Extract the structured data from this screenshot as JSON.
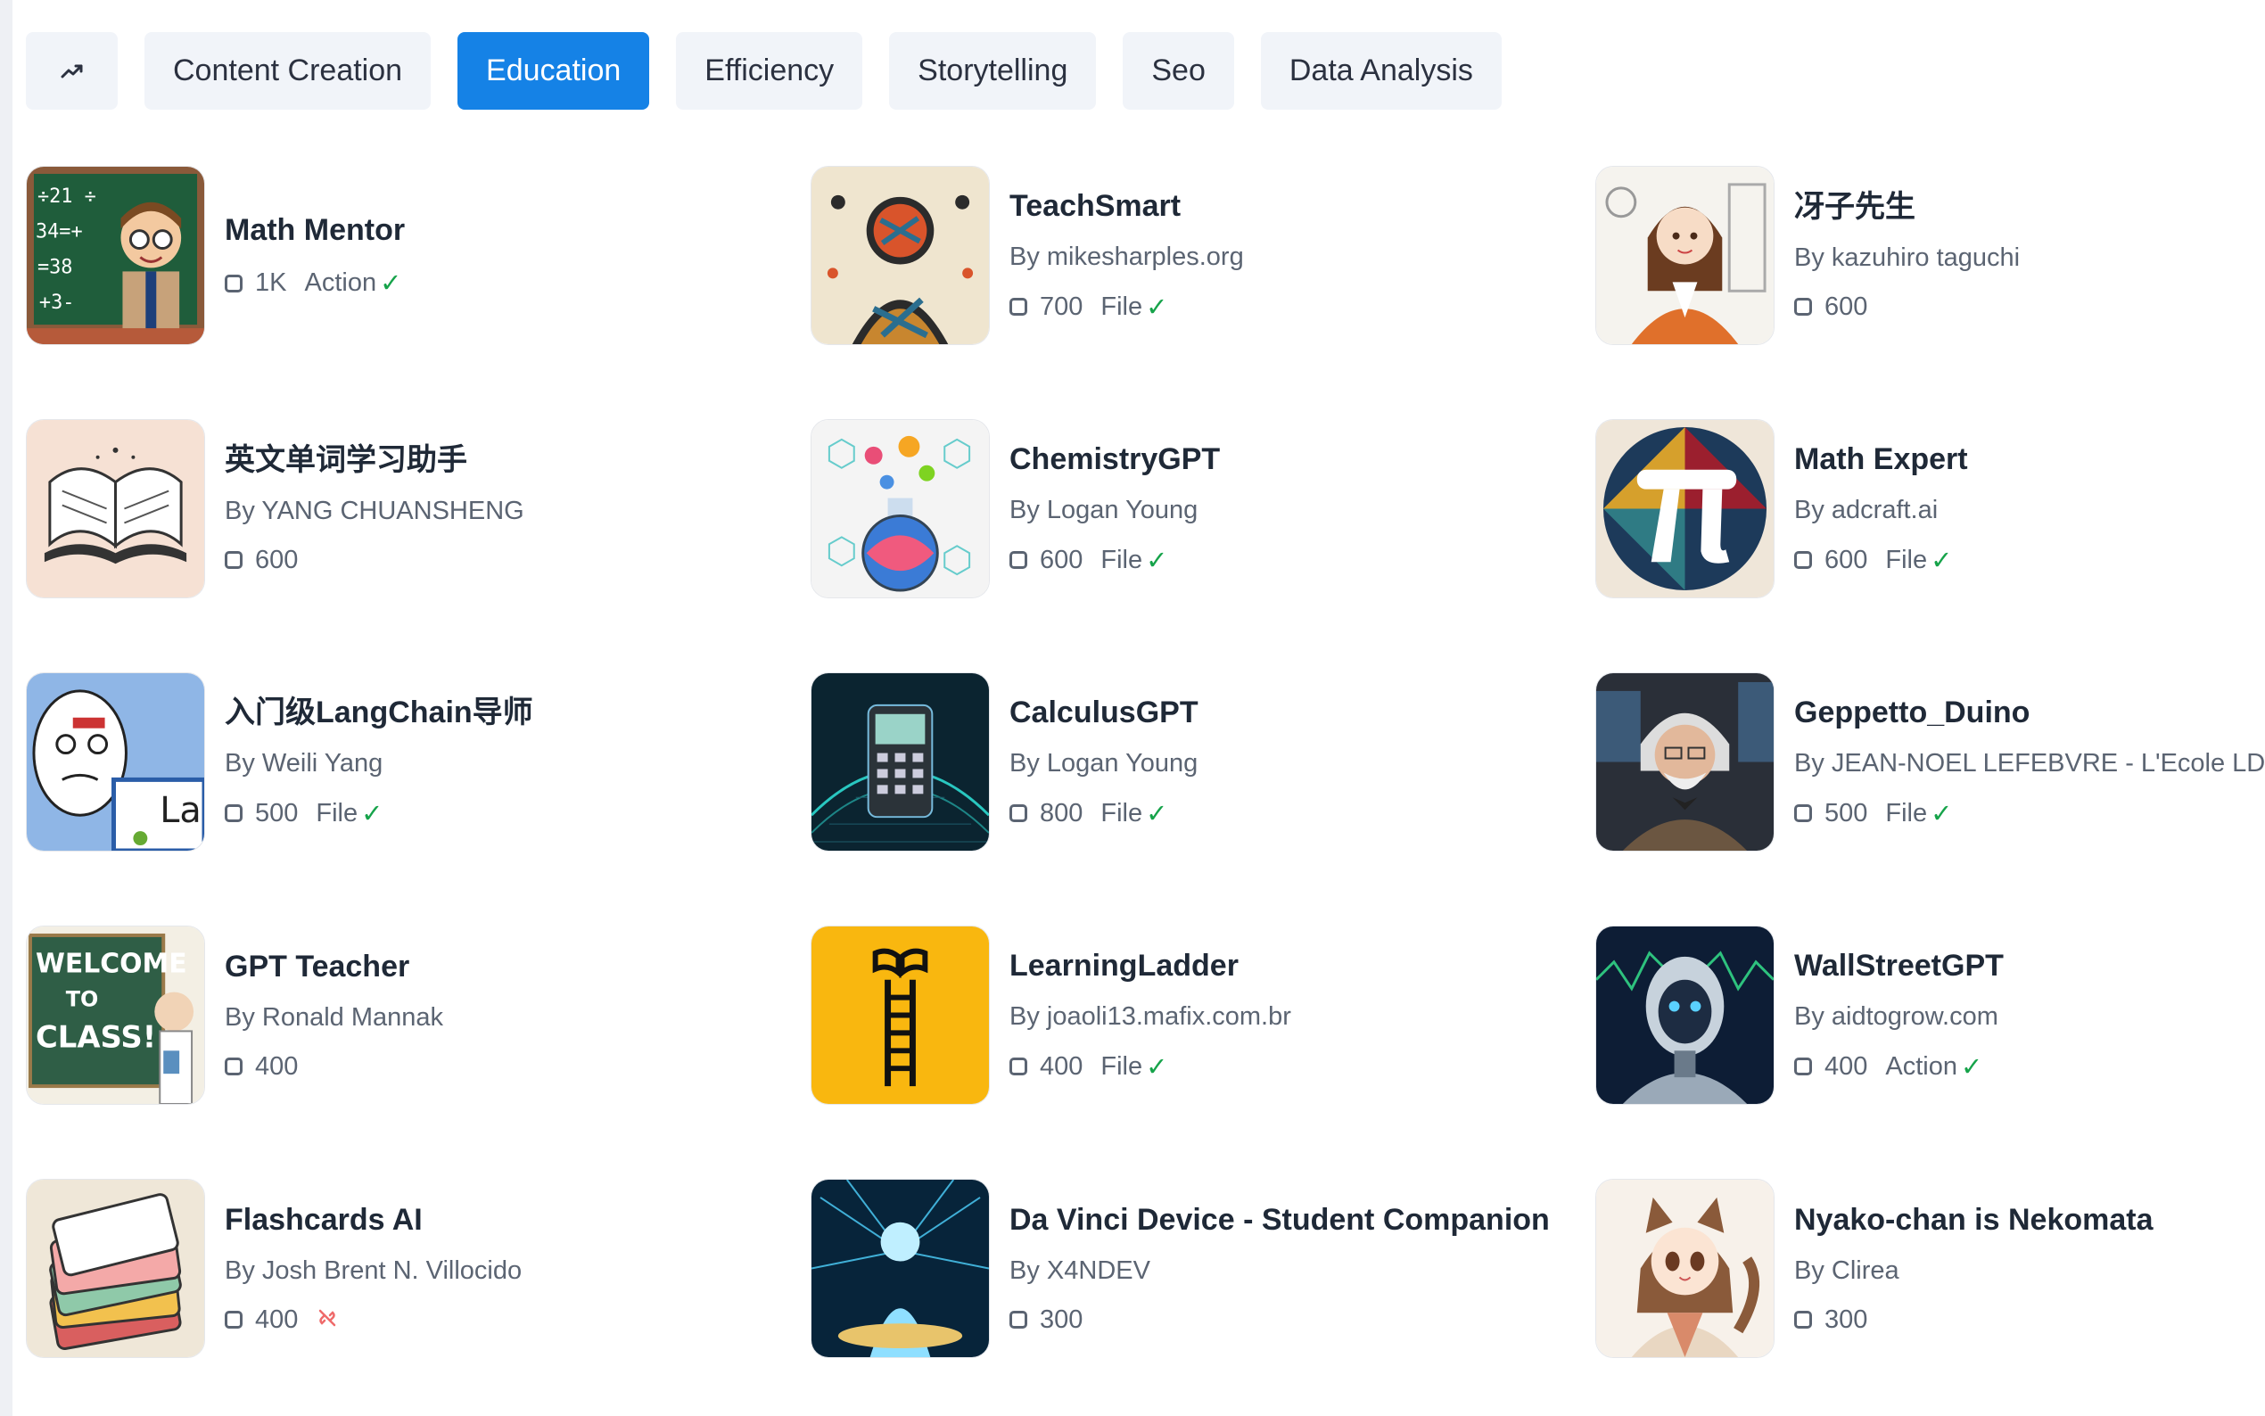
{
  "tabs": [
    {
      "label": "",
      "icon": "trending-up-icon",
      "active": false
    },
    {
      "label": "Content Creation",
      "active": false
    },
    {
      "label": "Education",
      "active": true
    },
    {
      "label": "Efficiency",
      "active": false
    },
    {
      "label": "Storytelling",
      "active": false
    },
    {
      "label": "Seo",
      "active": false
    },
    {
      "label": "Data Analysis",
      "active": false
    }
  ],
  "colors": {
    "accent": "#1582e6",
    "tab_bg": "#f1f4f9",
    "check": "#16a34a",
    "no_link": "#ef6b6b"
  },
  "gpts": [
    {
      "title": "Math Mentor",
      "author": "",
      "count": "1K",
      "feature": "Action",
      "feature_icon": "check-icon",
      "thumb": "cartoon-teacher-chalkboard"
    },
    {
      "title": "TeachSmart",
      "author": "By mikesharples.org",
      "count": "700",
      "feature": "File",
      "feature_icon": "check-icon",
      "thumb": "abstract-mosaic-figure"
    },
    {
      "title": "冴子先生",
      "author": "By kazuhiro taguchi",
      "count": "600",
      "feature": "",
      "feature_icon": "",
      "thumb": "anime-teacher-orange-blazer"
    },
    {
      "title": "英文单词学习助手",
      "author": "By YANG CHUANSHENG",
      "count": "600",
      "feature": "",
      "feature_icon": "",
      "thumb": "open-book-sketch"
    },
    {
      "title": "ChemistryGPT",
      "author": "By Logan Young",
      "count": "600",
      "feature": "File",
      "feature_icon": "check-icon",
      "thumb": "colorful-flask"
    },
    {
      "title": "Math Expert",
      "author": "By adcraft.ai",
      "count": "600",
      "feature": "File",
      "feature_icon": "check-icon",
      "thumb": "pi-symbol"
    },
    {
      "title": "入门级LangChain导师",
      "author": "By Weili Yang",
      "count": "500",
      "feature": "File",
      "feature_icon": "check-icon",
      "thumb": "meme-face-langchain"
    },
    {
      "title": "CalculusGPT",
      "author": "By Logan Young",
      "count": "800",
      "feature": "File",
      "feature_icon": "check-icon",
      "thumb": "calculator-graph"
    },
    {
      "title": "Geppetto_Duino",
      "author": "By JEAN-NOEL LEFEBVRE - L'Ecole LDLC",
      "count": "500",
      "feature": "File",
      "feature_icon": "check-icon",
      "thumb": "old-man-portrait"
    },
    {
      "title": "GPT Teacher",
      "author": "By Ronald Mannak",
      "count": "400",
      "feature": "",
      "feature_icon": "",
      "thumb": "welcome-to-class"
    },
    {
      "title": "LearningLadder",
      "author": "By joaoli13.mafix.com.br",
      "count": "400",
      "feature": "File",
      "feature_icon": "check-icon",
      "thumb": "book-ladder-yellow"
    },
    {
      "title": "WallStreetGPT",
      "author": "By aidtogrow.com",
      "count": "400",
      "feature": "Action",
      "feature_icon": "check-icon",
      "thumb": "robot-stock-charts"
    },
    {
      "title": "Flashcards AI",
      "author": "By Josh Brent N. Villocido",
      "count": "400",
      "feature": "",
      "feature_icon": "link-off-icon",
      "thumb": "flashcard-stack"
    },
    {
      "title": "Da Vinci Device - Student Companion",
      "author": "By X4NDEV",
      "count": "300",
      "feature": "",
      "feature_icon": "",
      "thumb": "glowing-figure"
    },
    {
      "title": "Nyako-chan is Nekomata",
      "author": "By Clirea",
      "count": "300",
      "feature": "",
      "feature_icon": "",
      "thumb": "anime-cat-girl"
    }
  ]
}
